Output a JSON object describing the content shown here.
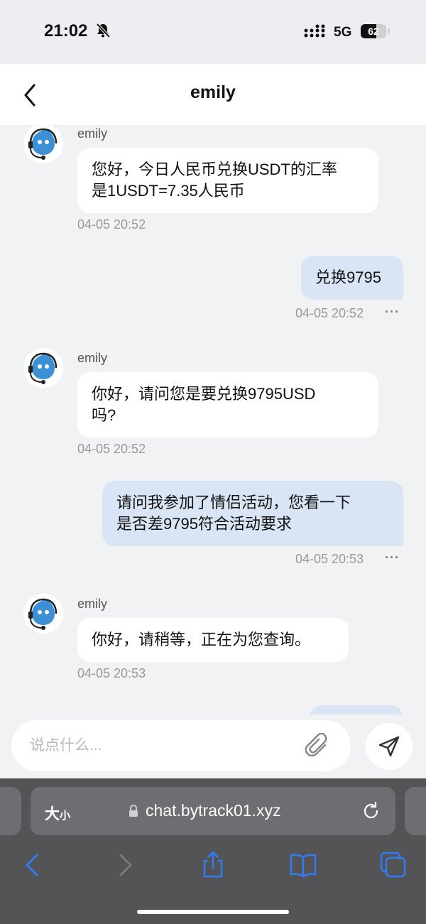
{
  "status_bar": {
    "time": "21:02",
    "network": "5G",
    "battery": "62",
    "battery_level": 0.62
  },
  "header": {
    "title": "emily"
  },
  "messages": [
    {
      "direction": "in",
      "sender": "emily",
      "lines": [
        "您好，今日人民币兑换USDT的汇率",
        "是1USDT=7.35人民币"
      ],
      "time": "04-05 20:52"
    },
    {
      "direction": "out",
      "lines": [
        "兑换9795"
      ],
      "time": "04-05 20:52"
    },
    {
      "direction": "in",
      "sender": "emily",
      "lines": [
        "你好，请问您是要兑换9795USD",
        "吗?"
      ],
      "time": "04-05 20:52"
    },
    {
      "direction": "out",
      "lines": [
        "请问我参加了情侣活动，您看一下",
        "是否差9795符合活动要求"
      ],
      "time": "04-05 20:53"
    },
    {
      "direction": "in",
      "sender": "emily",
      "lines": [
        "你好，请稍等，正在为您查询。"
      ],
      "time": "04-05 20:53"
    }
  ],
  "more_label": "···",
  "composer": {
    "placeholder": "说点什么..."
  },
  "browser": {
    "text_size_big": "大",
    "text_size_small": "小",
    "url": "chat.bytrack01.xyz"
  },
  "icons": [
    "bell-slash-icon",
    "signal-icon",
    "back-chevron-icon",
    "avatar-icon",
    "paperclip-icon",
    "send-icon",
    "lock-icon",
    "reload-icon",
    "nav-back-icon",
    "nav-forward-icon",
    "share-icon",
    "bookmarks-icon",
    "tabs-icon"
  ],
  "colors": {
    "accent": "#2f7cf6",
    "bubble_out": "#d9e4f4",
    "bubble_in": "#ffffff",
    "background": "#f1f2f4"
  }
}
